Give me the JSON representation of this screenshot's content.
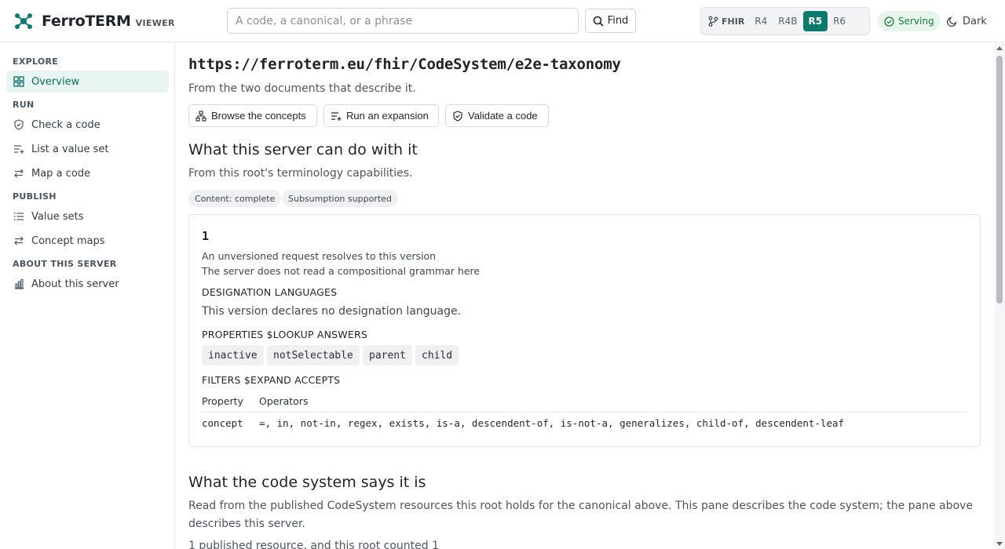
{
  "header": {
    "brand_name": "FerroTERM",
    "brand_sub": "VIEWER",
    "search_placeholder": "A code, a canonical, or a phrase",
    "find_label": "Find",
    "fhir_label": "FHIR",
    "versions": [
      "R4",
      "R4B",
      "R5",
      "R6"
    ],
    "active_version": "R5",
    "status": "Serving",
    "theme_toggle": "Dark"
  },
  "sidebar": {
    "sections": [
      {
        "heading": "EXPLORE",
        "items": [
          {
            "label": "Overview",
            "icon": "grid-icon",
            "active": true
          }
        ]
      },
      {
        "heading": "RUN",
        "items": [
          {
            "label": "Check a code",
            "icon": "shield-check-icon"
          },
          {
            "label": "List a value set",
            "icon": "list-plus-icon"
          },
          {
            "label": "Map a code",
            "icon": "arrows-swap-icon"
          }
        ]
      },
      {
        "heading": "PUBLISH",
        "items": [
          {
            "label": "Value sets",
            "icon": "list-icon"
          },
          {
            "label": "Concept maps",
            "icon": "arrows-swap-icon"
          }
        ]
      },
      {
        "heading": "ABOUT THIS SERVER",
        "items": [
          {
            "label": "About this server",
            "icon": "bar-chart-icon"
          }
        ]
      }
    ]
  },
  "main": {
    "canonical": "https://ferroterm.eu/fhir/CodeSystem/e2e-taxonomy",
    "canonical_sub": "From the two documents that describe it.",
    "actions": [
      "Browse the concepts",
      "Run an expansion",
      "Validate a code"
    ],
    "server_section": {
      "title": "What this server can do with it",
      "subtitle": "From this root's terminology capabilities.",
      "pills": [
        "Content: complete",
        "Subsumption supported"
      ],
      "card": {
        "version": "1",
        "notes": [
          "An unversioned request resolves to this version",
          "The server does not read a compositional grammar here"
        ],
        "designation_heading": "DESIGNATION LANGUAGES",
        "designation_text": "This version declares no designation language.",
        "properties_heading": "PROPERTIES $LOOKUP ANSWERS",
        "properties": [
          "inactive",
          "notSelectable",
          "parent",
          "child"
        ],
        "filters_heading": "FILTERS $EXPAND ACCEPTS",
        "filters_columns": [
          "Property",
          "Operators"
        ],
        "filters_rows": [
          {
            "property": "concept",
            "operators": "=, in, not-in, regex, exists, is-a, descendent-of, is-not-a, generalizes, child-of, descendent-leaf"
          }
        ]
      }
    },
    "codesystem_section": {
      "title": "What the code system says it is",
      "description": "Read from the published CodeSystem resources this root holds for the canonical above. This pane describes the code system; the pane above describes this server.",
      "partial_line": "1 published resource, and this root counted 1"
    }
  },
  "colors": {
    "accent": "#0e7a6d",
    "serving": "#1c7a43",
    "active_nav_bg": "#e9f5f2"
  }
}
